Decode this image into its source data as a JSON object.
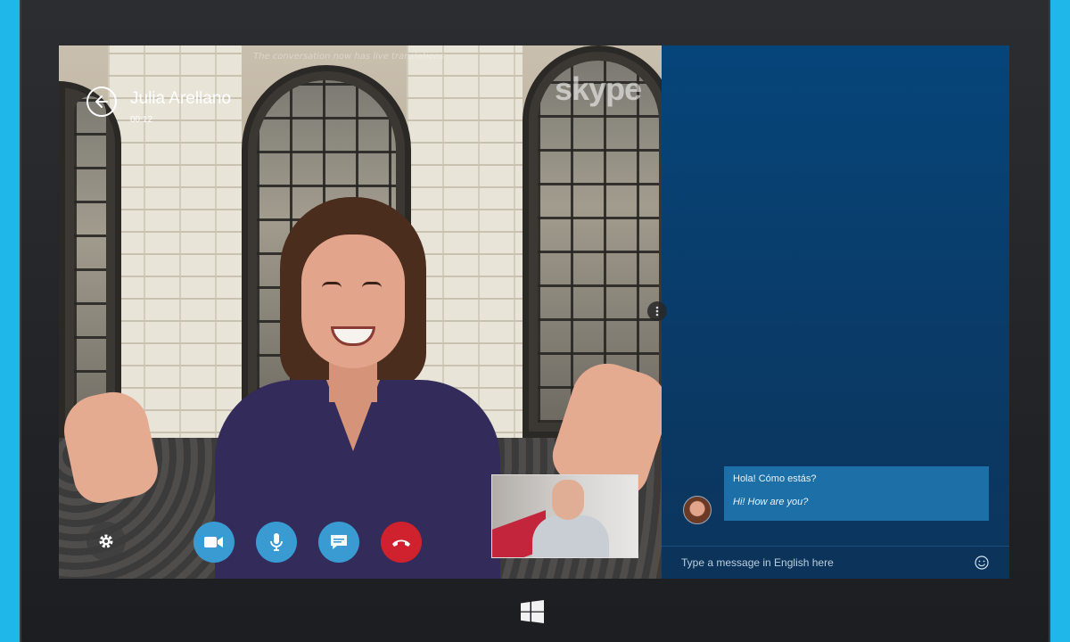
{
  "call": {
    "caption_text": "The conversation now has live translations",
    "watermark": "skype",
    "contact_name": "Julia Arellano",
    "duration": "00:12"
  },
  "controls": {
    "settings": "gear-icon",
    "video": "video-camera-icon",
    "mic": "microphone-icon",
    "chat": "chat-bubble-icon",
    "end": "hang-up-icon"
  },
  "chat": {
    "messages": [
      {
        "original": "Hola! Cómo estás?",
        "translation": "Hi! How are you?"
      }
    ],
    "compose_placeholder": "Type a message in English here"
  },
  "colors": {
    "accent_blue": "#3a9bd3",
    "end_call_red": "#d0222e",
    "chat_background": "#0a3a66",
    "bubble_blue": "#1d6fa8"
  }
}
